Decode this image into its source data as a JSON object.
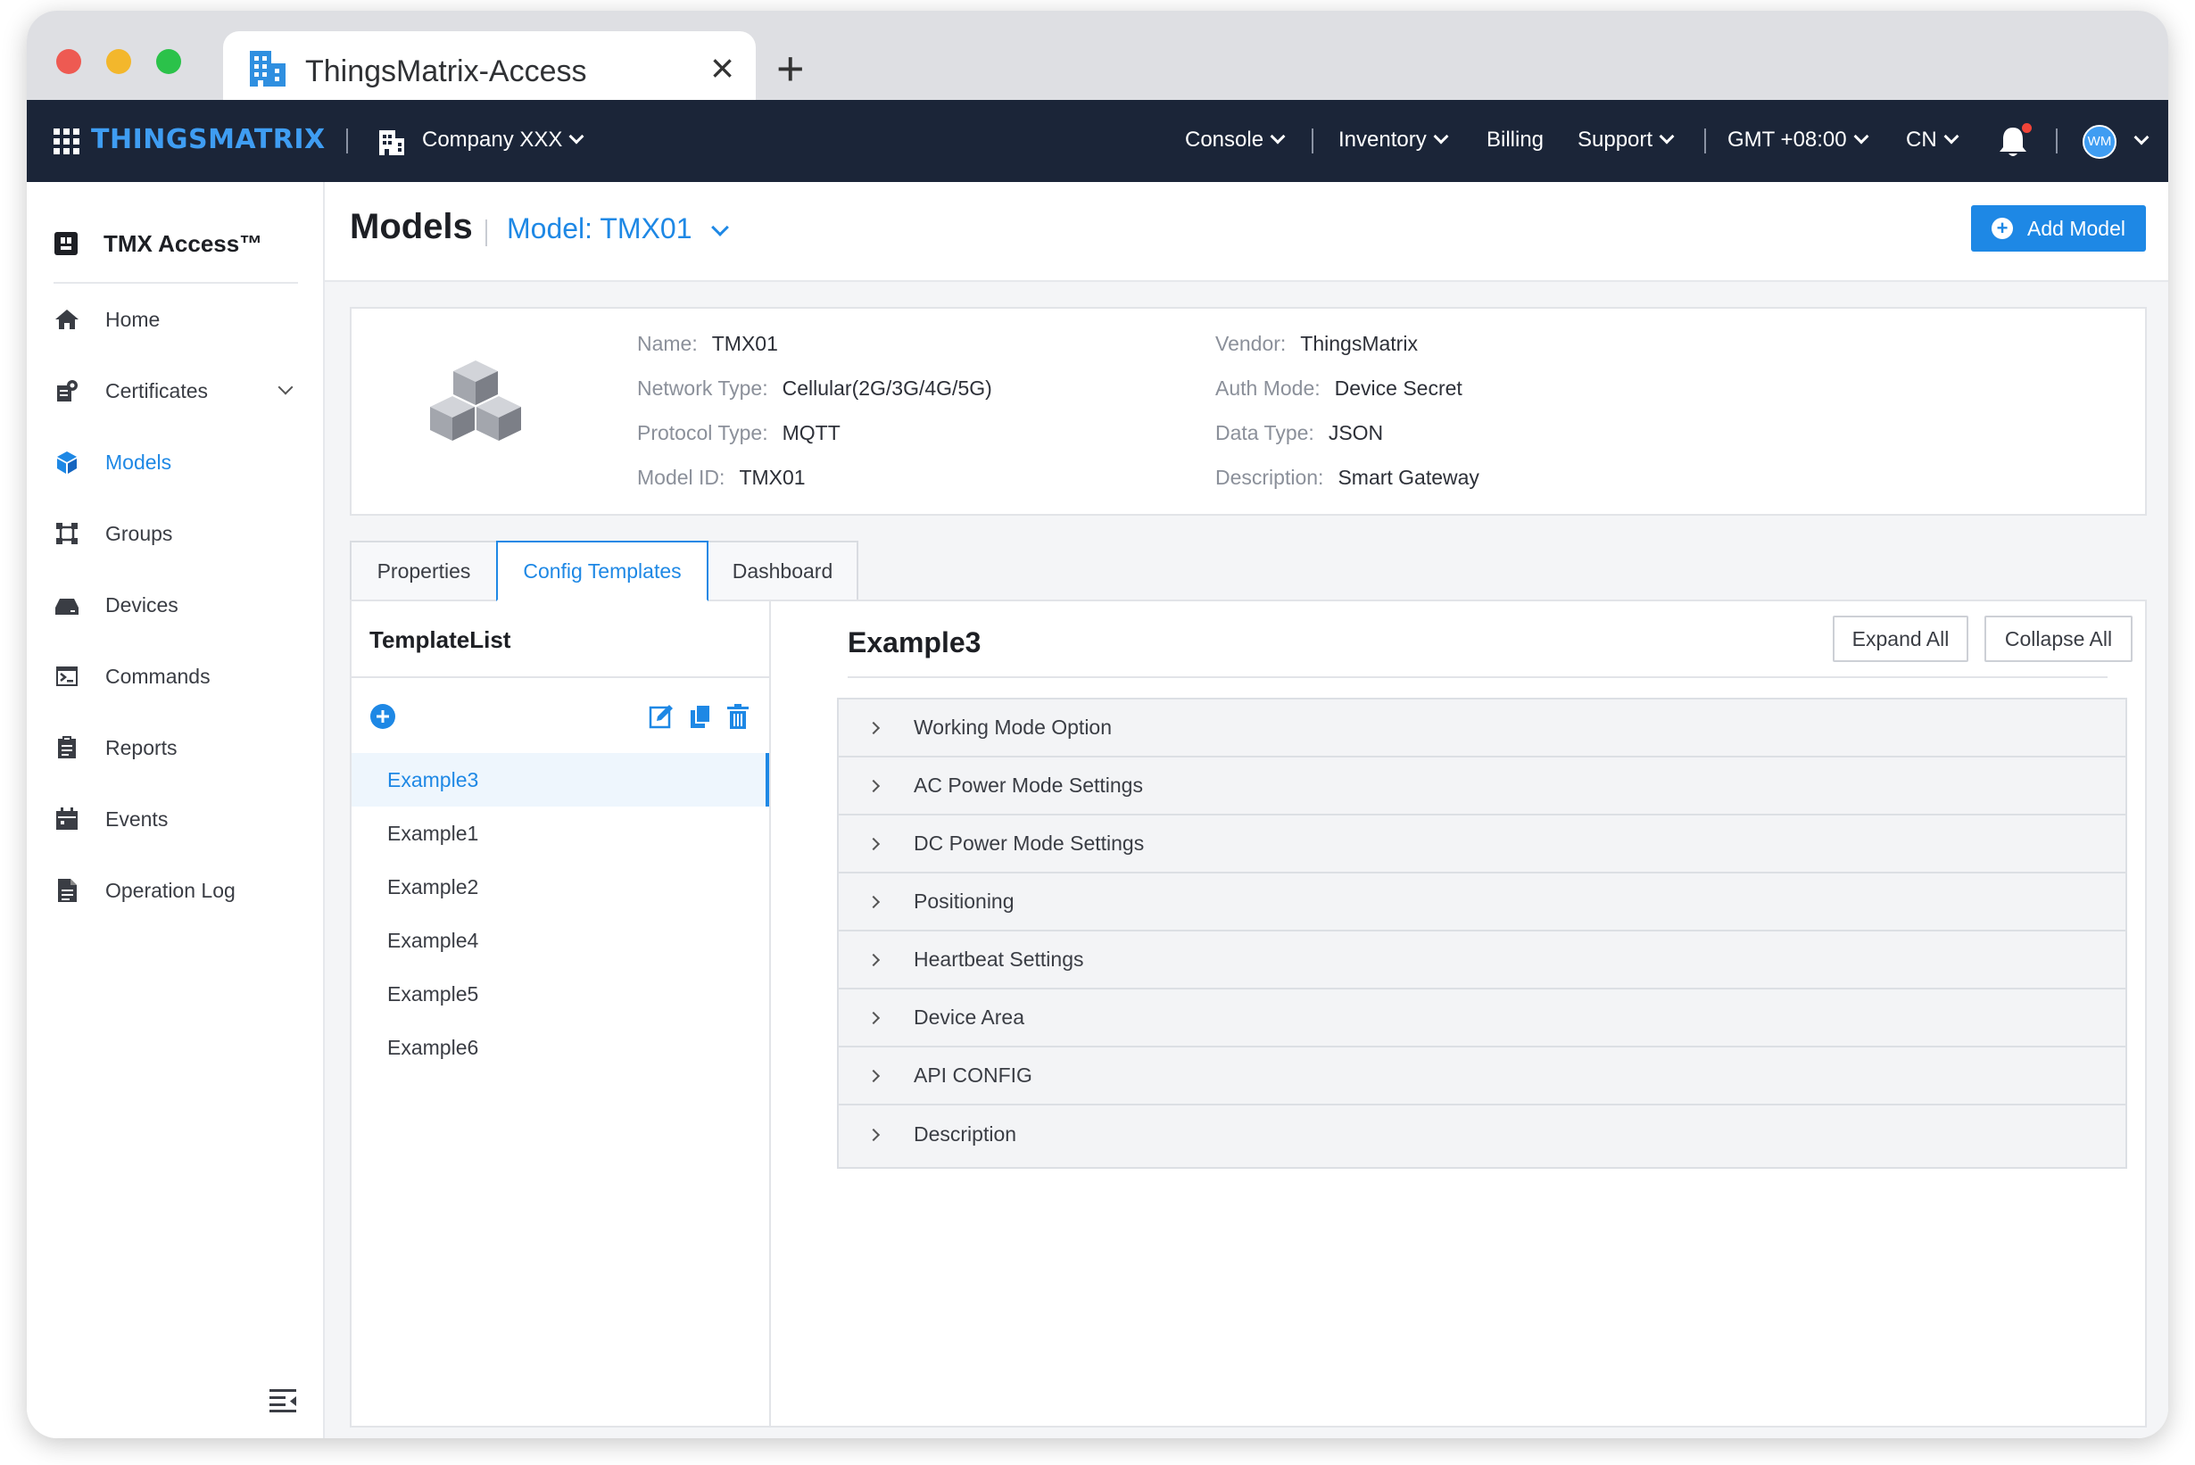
{
  "browser": {
    "tab_title": "ThingsMatrix-Access",
    "close_glyph": "×",
    "new_tab_glyph": "+"
  },
  "header": {
    "logo": "THINGSMATRIX",
    "company": "Company XXX",
    "nav": [
      "Console",
      "Inventory",
      "Billing",
      "Support"
    ],
    "timezone": "GMT +08:00",
    "language": "CN",
    "avatar_initials": "WM"
  },
  "sidebar": {
    "brand": "TMX Access™",
    "items": [
      {
        "label": "Home",
        "icon": "home-icon"
      },
      {
        "label": "Certificates",
        "icon": "certificate-icon"
      },
      {
        "label": "Models",
        "icon": "cube-icon"
      },
      {
        "label": "Groups",
        "icon": "groups-icon"
      },
      {
        "label": "Devices",
        "icon": "device-icon"
      },
      {
        "label": "Commands",
        "icon": "terminal-icon"
      },
      {
        "label": "Reports",
        "icon": "report-icon"
      },
      {
        "label": "Events",
        "icon": "calendar-icon"
      },
      {
        "label": "Operation Log",
        "icon": "log-icon"
      }
    ],
    "active": "Models"
  },
  "page": {
    "title": "Models",
    "model_select": "Model: TMX01",
    "add_button": "Add Model"
  },
  "model_info": {
    "name_label": "Name:",
    "name": "TMX01",
    "network_label": "Network Type:",
    "network": "Cellular(2G/3G/4G/5G)",
    "protocol_label": "Protocol Type:",
    "protocol": "MQTT",
    "model_id_label": "Model ID:",
    "model_id": "TMX01",
    "vendor_label": "Vendor:",
    "vendor": "ThingsMatrix",
    "auth_label": "Auth Mode:",
    "auth": "Device Secret",
    "data_type_label": "Data Type:",
    "data_type": "JSON",
    "description_label": "Description:",
    "description": "Smart Gateway"
  },
  "tabs": [
    "Properties",
    "Config Templates",
    "Dashboard"
  ],
  "active_tab": "Config Templates",
  "template_list": {
    "title": "TemplateList",
    "items": [
      "Example3",
      "Example1",
      "Example2",
      "Example4",
      "Example5",
      "Example6"
    ],
    "selected": "Example3"
  },
  "detail": {
    "title": "Example3",
    "expand_all": "Expand All",
    "collapse_all": "Collapse All",
    "sections": [
      "Working Mode Option",
      "AC Power Mode Settings",
      "DC Power Mode Settings",
      "Positioning",
      "Heartbeat Settings",
      "Device Area",
      "API CONFIG",
      "Description"
    ]
  },
  "colors": {
    "accent": "#1e88e5",
    "header_bg": "#1b2538",
    "logo": "#3f9df2"
  }
}
